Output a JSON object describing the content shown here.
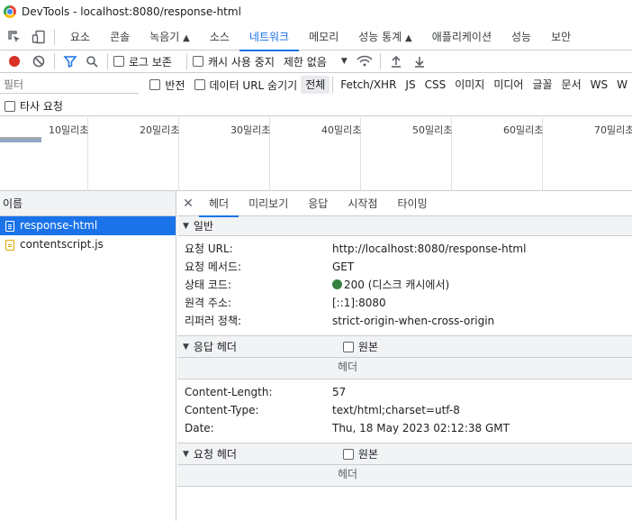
{
  "window": {
    "title": "DevTools - localhost:8080/response-html"
  },
  "tabs": [
    {
      "label": "요소"
    },
    {
      "label": "콘솔"
    },
    {
      "label": "녹음기"
    },
    {
      "label": "소스"
    },
    {
      "label": "네트워크"
    },
    {
      "label": "메모리"
    },
    {
      "label": "성능 통계"
    },
    {
      "label": "애플리케이션"
    },
    {
      "label": "성능"
    },
    {
      "label": "보안"
    }
  ],
  "toolbar": {
    "preserve_log": "로그 보존",
    "disable_cache": "캐시 사용 중지",
    "throttle": "제한 없음"
  },
  "filter": {
    "placeholder": "필터",
    "invert": "반전",
    "hide_data_urls": "데이터 URL 숨기기",
    "types": [
      "전체",
      "Fetch/XHR",
      "JS",
      "CSS",
      "이미지",
      "미디어",
      "글꼴",
      "문서",
      "WS",
      "W"
    ],
    "third_party": "타사 요청"
  },
  "timeline": {
    "ticks": [
      "10밀리초",
      "20밀리초",
      "30밀리초",
      "40밀리초",
      "50밀리초",
      "60밀리초",
      "70밀리초"
    ]
  },
  "requests": {
    "column": "이름",
    "items": [
      "response-html",
      "contentscript.js"
    ]
  },
  "detail": {
    "tabs": [
      "헤더",
      "미리보기",
      "응답",
      "시작점",
      "타이밍"
    ],
    "general": {
      "title": "일반",
      "rows": [
        {
          "k": "요청 URL:",
          "v": "http://localhost:8080/response-html"
        },
        {
          "k": "요청 메서드:",
          "v": "GET"
        },
        {
          "k": "상태 코드:",
          "v": "200 (디스크 캐시에서)"
        },
        {
          "k": "원격 주소:",
          "v": "[::1]:8080"
        },
        {
          "k": "리퍼러 정책:",
          "v": "strict-origin-when-cross-origin"
        }
      ]
    },
    "response_headers": {
      "title": "응답 헤더",
      "raw": "원본",
      "label": "헤더",
      "rows": [
        {
          "k": "Content-Length:",
          "v": "57"
        },
        {
          "k": "Content-Type:",
          "v": "text/html;charset=utf-8"
        },
        {
          "k": "Date:",
          "v": "Thu, 18 May 2023 02:12:38 GMT"
        }
      ]
    },
    "request_headers": {
      "title": "요청 헤더",
      "raw": "원본",
      "label": "헤더"
    }
  }
}
